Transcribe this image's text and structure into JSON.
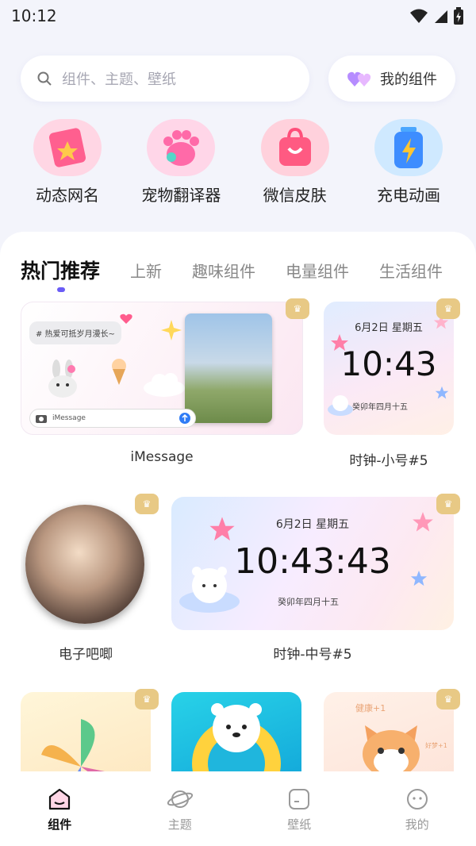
{
  "status": {
    "time": "10:12"
  },
  "search": {
    "placeholder": "组件、主题、壁纸"
  },
  "my_widgets": {
    "label": "我的组件"
  },
  "shortcuts": [
    {
      "label": "动态网名"
    },
    {
      "label": "宠物翻译器"
    },
    {
      "label": "微信皮肤"
    },
    {
      "label": "充电动画"
    }
  ],
  "tabs": [
    {
      "label": "热门推荐",
      "active": true
    },
    {
      "label": "上新"
    },
    {
      "label": "趣味组件"
    },
    {
      "label": "电量组件"
    },
    {
      "label": "生活组件"
    }
  ],
  "cards": {
    "imessage": {
      "title": "iMessage",
      "bubble_text": "# 热爱可抵岁月漫长~",
      "input_placeholder": "iMessage"
    },
    "clock_small": {
      "title": "时钟-小号#5",
      "date": "6月2日  星期五",
      "time": "10:43",
      "lunar": "癸卯年四月十五"
    },
    "avatar": {
      "title": "电子吧唧"
    },
    "clock_medium": {
      "title": "时钟-中号#5",
      "date": "6月2日  星期五",
      "time": "10:43:43",
      "lunar": "癸卯年四月十五"
    },
    "cat_card": {
      "badge_text": "健康+1",
      "sub_text": "好梦+1"
    }
  },
  "tabbar": [
    {
      "label": "组件",
      "active": true
    },
    {
      "label": "主题"
    },
    {
      "label": "壁纸"
    },
    {
      "label": "我的"
    }
  ]
}
